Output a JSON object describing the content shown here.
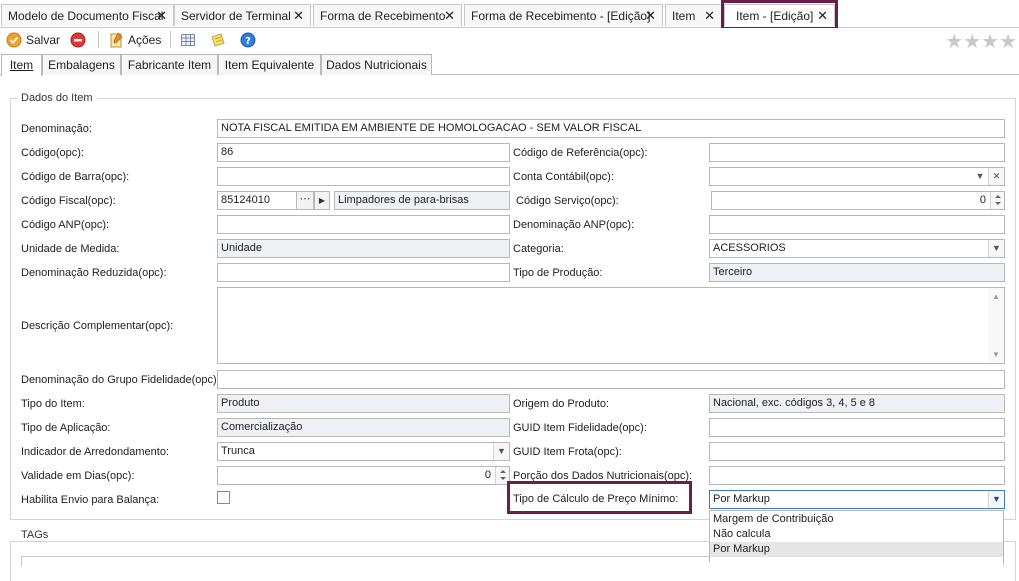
{
  "doc_tabs": [
    {
      "label": "Modelo de Documento Fiscal"
    },
    {
      "label": "Servidor de Terminal"
    },
    {
      "label": "Forma de Recebimento"
    },
    {
      "label": "Forma de Recebimento - [Edição]"
    },
    {
      "label": "Item"
    },
    {
      "label": "Item - [Edição]"
    }
  ],
  "toolbar": {
    "save_label": "Salvar",
    "actions_label": "Ações",
    "rating": "★★★★"
  },
  "content_tabs": [
    {
      "label": "Item"
    },
    {
      "label": "Embalagens"
    },
    {
      "label": "Fabricante Item"
    },
    {
      "label": "Item Equivalente"
    },
    {
      "label": "Dados Nutricionais"
    }
  ],
  "group_title": "Dados do Item",
  "tags_title": "TAGs",
  "fields": {
    "denominacao": {
      "label": "Denominação:",
      "value": "NOTA FISCAL EMITIDA EM AMBIENTE DE HOMOLOGACAO - SEM VALOR FISCAL"
    },
    "codigo": {
      "label": "Código(opc):",
      "value": "86"
    },
    "codigo_referencia": {
      "label": "Código de Referência(opc):",
      "value": ""
    },
    "codigo_barra": {
      "label": "Código de Barra(opc):",
      "value": ""
    },
    "conta_contabil": {
      "label": "Conta Contábil(opc):",
      "value": ""
    },
    "codigo_fiscal": {
      "label": "Código Fiscal(opc):",
      "value": "85124010",
      "desc": "Limpadores de para-brisas"
    },
    "codigo_servico": {
      "label": "Código Serviço(opc):",
      "value": "0"
    },
    "codigo_anp": {
      "label": "Código ANP(opc):",
      "value": ""
    },
    "denominacao_anp": {
      "label": "Denominação ANP(opc):",
      "value": ""
    },
    "unidade_medida": {
      "label": "Unidade de Medida:",
      "value": "Unidade"
    },
    "categoria": {
      "label": "Categoria:",
      "value": "ACESSORIOS"
    },
    "denominacao_reduzida": {
      "label": "Denominação Reduzida(opc):",
      "value": ""
    },
    "tipo_producao": {
      "label": "Tipo de Produção:",
      "value": "Terceiro"
    },
    "descricao_complementar": {
      "label": "Descrição Complementar(opc):",
      "value": ""
    },
    "denominacao_grupo_fidelidade": {
      "label": "Denominação do Grupo Fidelidade(opc):",
      "value": ""
    },
    "tipo_item": {
      "label": "Tipo do Item:",
      "value": "Produto"
    },
    "origem_produto": {
      "label": "Origem do Produto:",
      "value": "Nacional, exc. códigos 3, 4, 5 e 8"
    },
    "tipo_aplicacao": {
      "label": "Tipo de Aplicação:",
      "value": "Comercialização"
    },
    "guid_fidelidade": {
      "label": "GUID Item Fidelidade(opc):",
      "value": ""
    },
    "indicador_arredondamento": {
      "label": "Indicador de Arredondamento:",
      "value": "Trunca"
    },
    "guid_frota": {
      "label": "GUID Item Frota(opc):",
      "value": ""
    },
    "validade_dias": {
      "label": "Validade em Dias(opc):",
      "value": "0"
    },
    "porcao_nutricionais": {
      "label": "Porção dos Dados Nutricionais(opc):",
      "value": ""
    },
    "habilita_balanca": {
      "label": "Habilita Envio para Balança:"
    },
    "tipo_calculo_preco": {
      "label": "Tipo de Cálculo de Preço Mínimo:",
      "value": "Por Markup"
    }
  },
  "preco_minimo_options": [
    {
      "label": "Margem de Contribuição"
    },
    {
      "label": "Não calcula"
    },
    {
      "label": "Por Markup"
    }
  ],
  "colors": {
    "highlight": "#6a1e4a",
    "readonly_bg": "#eef1f5",
    "border": "#b8b8b8"
  }
}
